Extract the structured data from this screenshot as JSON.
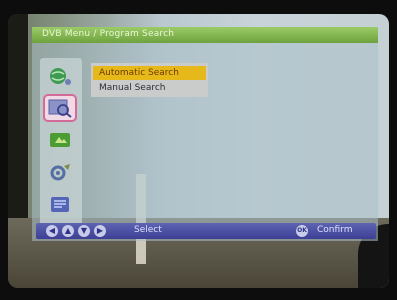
{
  "title_bar": {
    "title": "DVB Menu / Program Search"
  },
  "sidebar": {
    "icons": [
      {
        "name": "globe-icon"
      },
      {
        "name": "program-search-icon",
        "active": true
      },
      {
        "name": "media-icon"
      },
      {
        "name": "settings-icon"
      },
      {
        "name": "info-icon"
      }
    ]
  },
  "menu": {
    "items": [
      {
        "label": "Automatic Search",
        "selected": true
      },
      {
        "label": "Manual Search",
        "selected": false
      }
    ]
  },
  "status_bar": {
    "nav_keys": [
      "◀",
      "▲",
      "▼",
      "▶"
    ],
    "select_label": "Select",
    "confirm_key": "OK",
    "confirm_label": "Confirm"
  },
  "colors": {
    "title_green": "#7fb24a",
    "highlight_yellow": "#e6b81a",
    "status_blue": "#4a4fa3",
    "active_icon_border": "#d36b9a"
  }
}
